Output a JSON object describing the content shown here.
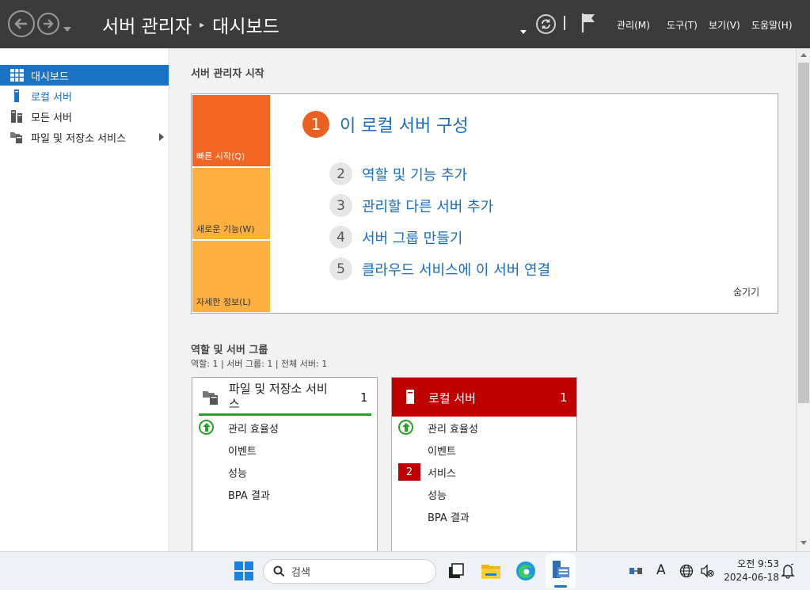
{
  "header": {
    "breadcrumb_root": "서버 관리자",
    "breadcrumb_sep": "▸",
    "breadcrumb_current": "대시보드",
    "menus": [
      "관리(M)",
      "도구(T)",
      "보기(V)",
      "도움말(H)"
    ]
  },
  "sidebar": {
    "items": [
      {
        "label": "대시보드",
        "icon": "dashboard-icon"
      },
      {
        "label": "로컬 서버",
        "icon": "server-icon"
      },
      {
        "label": "모든 서버",
        "icon": "servers-icon"
      },
      {
        "label": "파일 및 저장소 서비스",
        "icon": "folder-icon"
      }
    ]
  },
  "welcome": {
    "title": "서버 관리자 시작",
    "tiles": [
      "빠른 시작(Q)",
      "새로운 기능(W)",
      "자세한 정보(L)"
    ],
    "main_step": {
      "num": "1",
      "label": "이 로컬 서버 구성"
    },
    "steps": [
      {
        "num": "2",
        "label": "역할 및 기능 추가"
      },
      {
        "num": "3",
        "label": "관리할 다른 서버 추가"
      },
      {
        "num": "4",
        "label": "서버 그룹 만들기"
      },
      {
        "num": "5",
        "label": "클라우드 서비스에 이 서버 연결"
      }
    ],
    "hide": "숨기기"
  },
  "roles": {
    "title": "역할 및 서버 그룹",
    "counts": "역할: 1   |   서버 그룹: 1   |   전체 서버: 1",
    "cards": [
      {
        "title_line1": "파일 및 저장소 서비",
        "title_line2": "스",
        "count": "1",
        "rows": [
          "관리 효율성",
          "이벤트",
          "성능",
          "BPA 결과"
        ]
      },
      {
        "title": "로컬 서버",
        "count": "1",
        "rows": [
          "관리 효율성",
          "이벤트",
          "서비스",
          "성능",
          "BPA 결과"
        ],
        "service_badge": "2"
      }
    ]
  },
  "taskbar": {
    "search_placeholder": "검색",
    "ime": "A",
    "time": "오전 9:53",
    "date": "2024-06-18"
  },
  "colors": {
    "header_bg": "#3b3b3b",
    "accent_blue": "#1a73c4",
    "tile_orange": "#f26522",
    "tile_yellow": "#fbb040",
    "local_server_red": "#c00000",
    "ok_green": "#27a127"
  }
}
